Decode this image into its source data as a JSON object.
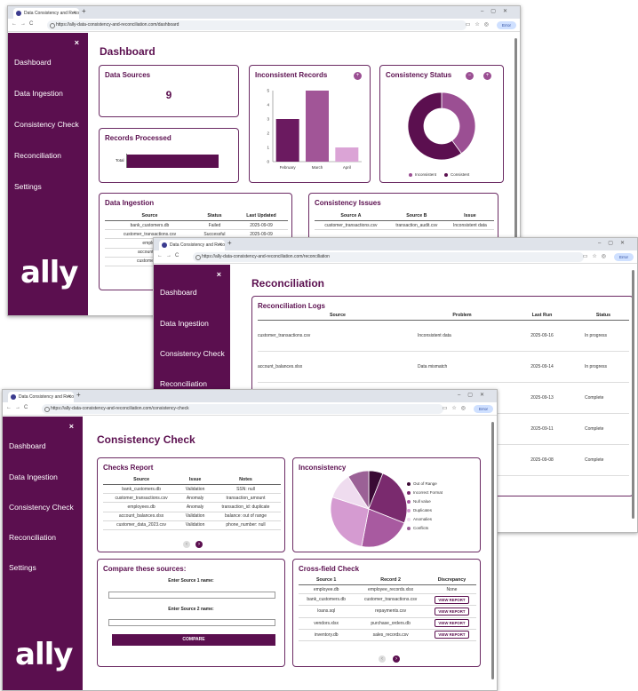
{
  "browser": {
    "dashboard_tab": "Data Consistency and Reco",
    "dashboard_url": "https://ally-data-consistency-and-reconciliation.com/dashboard",
    "recon_tab": "Data Consistency and Reco",
    "recon_url": "https://ally-data-consistency-and-reconciliation.com/reconciliation",
    "check_tab": "Data Consistency and Reco",
    "check_url": "https://ally-data-consistency-and-reconciliation.com/consistency-check",
    "error_label": "Error",
    "new_tab": "+",
    "close": "×"
  },
  "sidebar": {
    "close": "×",
    "items": [
      "Dashboard",
      "Data Ingestion",
      "Consistency Check",
      "Reconciliation",
      "Settings"
    ],
    "logo": "ally"
  },
  "dashboard": {
    "title": "Dashboard",
    "data_sources": {
      "title": "Data Sources",
      "value": "9"
    },
    "records_processed": {
      "title": "Records Processed",
      "label": "Total"
    },
    "inconsistent_records": {
      "title": "Inconsistent Records",
      "plus": "+"
    },
    "consistency_status": {
      "title": "Consistency Status",
      "minus": "−",
      "plus": "+",
      "legend": [
        "Inconsistent",
        "Consistent"
      ]
    },
    "ingestion": {
      "title": "Data Ingestion",
      "headers": [
        "Source",
        "Status",
        "Last Updated"
      ],
      "rows": [
        [
          "bank_customers.db",
          "Failed",
          "2025-09-09"
        ],
        [
          "customer_transactions.csv",
          "Successful",
          "2025-09-09"
        ],
        [
          "employ",
          "",
          ""
        ],
        [
          "account_bal",
          "",
          ""
        ],
        [
          "customer_da",
          "",
          ""
        ]
      ]
    },
    "issues": {
      "title": "Consistency Issues",
      "headers": [
        "Source A",
        "Source B",
        "Issue"
      ],
      "rows": [
        [
          "customer_transactions.csv",
          "transaction_audit.csv",
          "Inconsistent data"
        ]
      ]
    }
  },
  "chart_data": {
    "type": "bar",
    "title": "Inconsistent Records",
    "categories": [
      "February",
      "March",
      "April"
    ],
    "values": [
      3,
      5,
      1
    ],
    "ylim": [
      0,
      5
    ],
    "yticks": [
      "0",
      "1",
      "2",
      "3",
      "4",
      "5"
    ],
    "colors": [
      "#6b1a60",
      "#a15597",
      "#dba4d6"
    ]
  },
  "donut": {
    "values": [
      40,
      60
    ],
    "colors": [
      "#9b4f93",
      "#5b0f4f"
    ]
  },
  "reconciliation": {
    "title": "Reconciliation",
    "logs": {
      "title": "Reconciliation Logs",
      "headers": [
        "Source",
        "Problem",
        "Last Run",
        "Status"
      ],
      "rows": [
        [
          "customer_transactions.csv",
          "Inconsistent data",
          "2025-09-16",
          "In progress"
        ],
        [
          "account_balances.xlsx",
          "Data mismatch",
          "2025-09-14",
          "In progress"
        ],
        [
          "",
          "",
          "2025-09-13",
          "Complete"
        ],
        [
          "",
          "",
          "2025-09-11",
          "Complete"
        ],
        [
          "",
          "",
          "2025-09-08",
          "Complete"
        ]
      ]
    }
  },
  "check": {
    "title": "Consistency Check",
    "report": {
      "title": "Checks Report",
      "headers": [
        "Source",
        "Issue",
        "Notes"
      ],
      "rows": [
        [
          "bank_customers.db",
          "Validation",
          "SSN: null"
        ],
        [
          "customer_transactions.csv",
          "Anomaly",
          "transaction_amount"
        ],
        [
          "employees.db",
          "Anomaly",
          "transaction_id: duplicate"
        ],
        [
          "account_balances.xlsx",
          "Validation",
          "balance: out of range"
        ],
        [
          "customer_data_2023.csv",
          "Validation",
          "phone_number: null"
        ]
      ],
      "prev": "‹",
      "next": "›"
    },
    "inconsistency": {
      "title": "Inconsistency",
      "legend": [
        "Out of Range",
        "Incorrect Format",
        "Null value",
        "Duplicates",
        "Anomalies",
        "Conflicts"
      ],
      "values": [
        6,
        25,
        22,
        27,
        11,
        9
      ],
      "colors": [
        "#3a0a35",
        "#7a2a6e",
        "#a85aa0",
        "#d59bd1",
        "#efdcef",
        "#9b6196"
      ]
    },
    "compare": {
      "title": "Compare these sources:",
      "label1": "Enter Source 1 name:",
      "label2": "Enter Source 2 name:",
      "button": "COMPARE"
    },
    "crossfield": {
      "title": "Cross-field Check",
      "headers": [
        "Source 1",
        "Record 2",
        "Discrepancy"
      ],
      "rows": [
        [
          "employee.db",
          "employee_records.xlsx",
          "None"
        ],
        [
          "bank_customers.db",
          "customer_transactions.csv",
          "VIEW REPORT"
        ],
        [
          "loans.sql",
          "repayments.csv",
          "VIEW REPORT"
        ],
        [
          "vendors.xlsx",
          "purchase_orders.db",
          "VIEW REPORT"
        ],
        [
          "inventory.db",
          "sales_records.csv",
          "VIEW REPORT"
        ]
      ]
    }
  }
}
